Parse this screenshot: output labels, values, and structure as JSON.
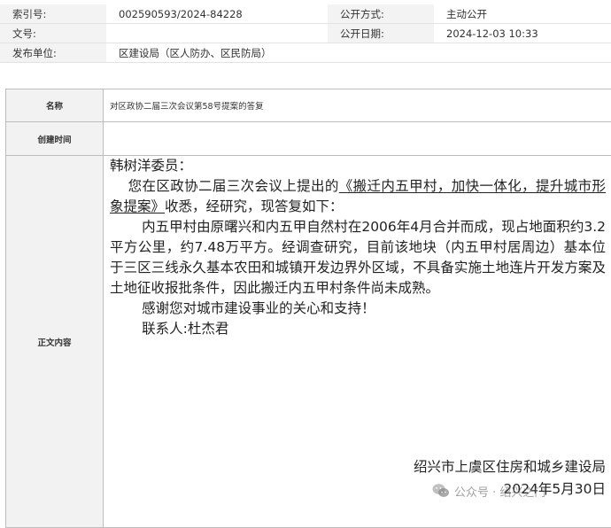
{
  "meta": {
    "index_label": "索引号:",
    "index_value": "002590593/2024-84228",
    "open_mode_label": "公开方式:",
    "open_mode_value": "主动公开",
    "doc_no_label": "文号:",
    "doc_no_value": "",
    "open_date_label": "公开日期:",
    "open_date_value": "2024-12-03 10:33",
    "publisher_label": "发布单位:",
    "publisher_value": "区建设局（区人防办、区民防局）"
  },
  "record": {
    "name_label": "名称",
    "name_value": "对区政协二届三次会议第58号提案的答复",
    "created_label": "创建时间",
    "created_value": "",
    "body_label": "正文内容"
  },
  "letter": {
    "salutation": "韩树洋委员：",
    "para1_prefix": "您在区政协二届三次会议上提出的",
    "proposal_title": "《搬迁内五甲村，加快一体化，提升城市形象提案》",
    "para1_suffix": "收悉，经研究，现答复如下：",
    "para2": "内五甲村由原曙兴和内五甲自然村在2006年4月合并而成，现占地面积约3.2平方公里，约7.48万平方。经调查研究，目前该地块（内五甲村居周边）基本位于三区三线永久基本农田和城镇开发边界外区域，不具备实施土地连片开发方案及土地征收报批条件，因此搬迁内五甲村条件尚未成熟。",
    "para3": "感谢您对城市建设事业的关心和支持！",
    "contact": "联系人:杜杰君",
    "signature_org": "绍兴市上虞区住房和城乡建设局",
    "signature_date": "2024年5月30日"
  },
  "watermark": {
    "text": "公众号 · 绍兴之门",
    "icon": "wechat-icon"
  }
}
